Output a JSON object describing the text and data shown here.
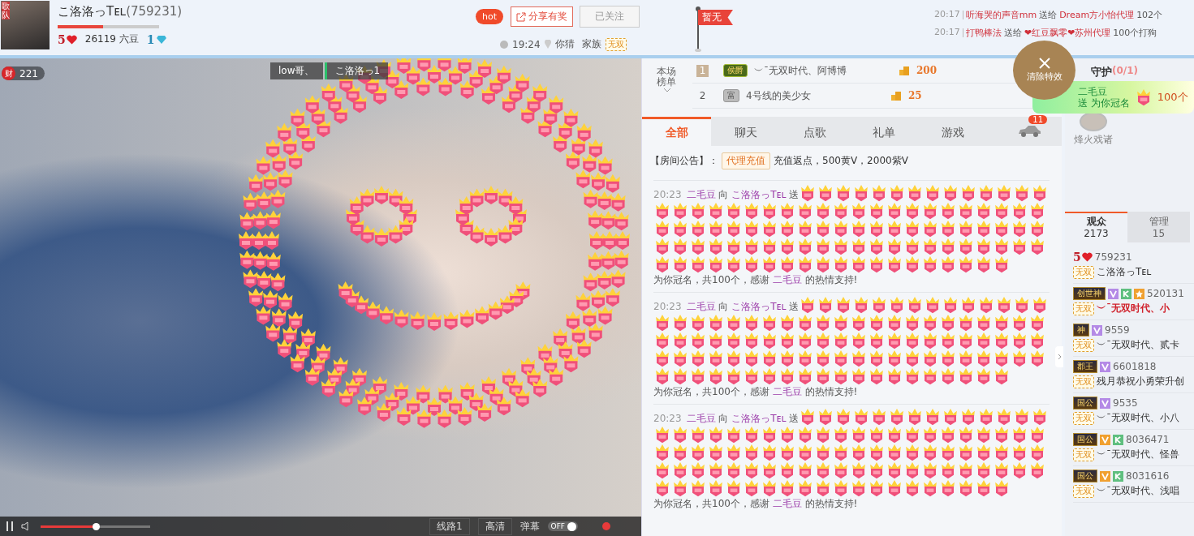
{
  "header": {
    "avatar_badge": "歌队",
    "name": "こ洛洛っTᴇʟ",
    "room_id": "(759231)",
    "progress": {
      "level": 0.45
    },
    "host_level": "5",
    "beans": "26119 六豆",
    "diamond_level": "1",
    "hot": "hot",
    "share_button": "分享有奖",
    "follow_button": {
      "label": "已关注",
      "disabled": true
    },
    "time": "19:24",
    "location": "你猜",
    "family_label": "家族",
    "family_tag": "无双",
    "flag": "暂无"
  },
  "ticker": [
    {
      "time": "20:17",
      "from": "听海哭的声音mm",
      "verb": "送给",
      "to": "Dream方小怡代理",
      "gift": "102个"
    },
    {
      "time": "20:17",
      "from": "打鸭棒法",
      "verb": "送给",
      "to": "❤红豆飘零❤苏州代理",
      "gift": "100个打狗"
    }
  ],
  "video": {
    "wealth_badge": "财",
    "wealth_count": "221",
    "name_tags": [
      "low哥、",
      "こ洛洛っ1"
    ],
    "controls": {
      "volume": {
        "level": 0.5
      },
      "line": "线路1",
      "quality": "高清",
      "danmaku": "弹幕",
      "danmaku_switch": {
        "on": false,
        "label": "OFF"
      }
    }
  },
  "ranking": {
    "title": "本场榜单",
    "rows": [
      {
        "rank": "1",
        "badge": "侯爵",
        "name": "︶ˉ无双时代、阿博博",
        "score": "200",
        "selected": true
      },
      {
        "rank": "2",
        "badge": "富",
        "name": "4号线的美少女",
        "score": "25",
        "selected": false
      }
    ]
  },
  "clear_effects": "清除特效",
  "gift_banner": {
    "sender": "二毛豆",
    "text": "送 为你冠名",
    "count": "100个"
  },
  "chat_tabs": [
    {
      "label": "全部",
      "selected": true
    },
    {
      "label": "聊天",
      "selected": false
    },
    {
      "label": "点歌",
      "selected": false
    },
    {
      "label": "礼单",
      "selected": false
    },
    {
      "label": "游戏",
      "selected": false
    }
  ],
  "car_badge": "11",
  "notice": {
    "label": "【房间公告】：",
    "tag": "代理充值",
    "text": "充值返点，500黄V，2000紫V"
  },
  "messages": [
    {
      "time": "20:23",
      "sender": "二毛豆",
      "to_word": "向",
      "receiver": "こ洛洛っTᴇʟ",
      "verb": "送",
      "tail": "为你冠名，共100个，感谢",
      "thanks_name": "二毛豆",
      "end": "的热情支持!"
    },
    {
      "time": "20:23",
      "sender": "二毛豆",
      "to_word": "向",
      "receiver": "こ洛洛っTᴇʟ",
      "verb": "送",
      "tail": "为你冠名，共100个，感谢",
      "thanks_name": "二毛豆",
      "end": "的热情支持!"
    },
    {
      "time": "20:23",
      "sender": "二毛豆",
      "to_word": "向",
      "receiver": "こ洛洛っTᴇʟ",
      "verb": "送",
      "tail": "为你冠名，共100个，感谢",
      "thanks_name": "二毛豆",
      "end": "的热情支持!"
    }
  ],
  "guard": {
    "title": "守护",
    "count": "(0/1)",
    "name": "烽火戏诸"
  },
  "audience_tabs": [
    {
      "label": "观众",
      "count": "2173",
      "selected": true
    },
    {
      "label": "管理",
      "count": "15",
      "selected": false
    }
  ],
  "users": [
    {
      "rank": "5",
      "kind": "level",
      "id": "759231",
      "tag": "无双",
      "name": "こ洛洛っTᴇʟ",
      "highlight": false
    },
    {
      "rank": "创世神",
      "kind": "title",
      "badges": [
        {
          "kind": "v",
          "color": "#b48ae6"
        },
        {
          "kind": "k",
          "color": "#5fbf7f"
        },
        {
          "kind": "star",
          "color": "#f0a030"
        }
      ],
      "id": "520131",
      "tag": "无双",
      "name": "︶ˉ无双时代、小",
      "highlight": true
    },
    {
      "rank": "神",
      "kind": "title",
      "badges": [
        {
          "kind": "v",
          "color": "#b48ae6"
        }
      ],
      "id": "9559",
      "tag": "无双",
      "name": "︶ˉ无双时代、贰卡",
      "highlight": false
    },
    {
      "rank": "郡王",
      "kind": "title",
      "badges": [
        {
          "kind": "v",
          "color": "#b48ae6"
        }
      ],
      "id": "6601818",
      "tag": "无双",
      "name": "残月恭祝小勇荣升创",
      "highlight": false
    },
    {
      "rank": "国公",
      "kind": "title",
      "badges": [
        {
          "kind": "v",
          "color": "#b48ae6"
        }
      ],
      "id": "9535",
      "tag": "无双",
      "name": "︶ˉ无双时代、小八",
      "highlight": false
    },
    {
      "rank": "国公",
      "kind": "title",
      "badges": [
        {
          "kind": "v",
          "color": "#f0a030"
        },
        {
          "kind": "k",
          "color": "#5fbf7f"
        }
      ],
      "id": "8036471",
      "tag": "无双",
      "name": "︶ˉ无双时代、怪兽",
      "highlight": false
    },
    {
      "rank": "国公",
      "kind": "title",
      "badges": [
        {
          "kind": "v",
          "color": "#f0a030"
        },
        {
          "kind": "k",
          "color": "#5fbf7f"
        }
      ],
      "id": "8031616",
      "tag": "无双",
      "name": "︶ˉ无双时代、浅唱",
      "highlight": false
    }
  ]
}
